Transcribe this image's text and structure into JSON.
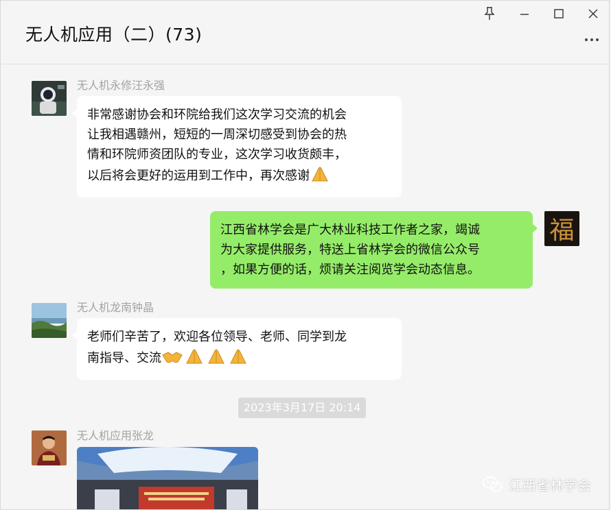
{
  "window": {
    "title": "无人机应用（二）(73)",
    "controls": [
      "pin-icon",
      "minimize-icon",
      "maximize-icon",
      "close-icon"
    ],
    "more_icon": "more-icon"
  },
  "messages": [
    {
      "sender": "无人机永修汪永强",
      "lines": [
        "非常感谢协会和环院给我们这次学习交流的机会",
        "让我相遇赣州，短短的一周深切感受到协会的热",
        "情和环院师资团队的专业，这次学习收货颇丰，",
        "以后将会更好的运用到工作中，再次感谢"
      ],
      "emoji": [
        "folded-hands"
      ],
      "avatar": "astronaut-avatar"
    },
    {
      "sender": "",
      "lines": [
        "江西省林学会是广大林业科技工作者之家，竭诚",
        "为大家提供服务，特送上省林学会的微信公众号",
        "，如果方便的话，烦请关注阅览学会动态信息。"
      ],
      "avatar": "fu-character-avatar"
    },
    {
      "sender": "无人机龙南钟晶",
      "lines": [
        "老师们辛苦了，欢迎各位领导、老师、同学到龙",
        "南指导、交流"
      ],
      "emoji": [
        "handshake",
        "folded-hands",
        "folded-hands",
        "folded-hands"
      ],
      "avatar": "landscape-avatar"
    }
  ],
  "timestamp": "2023年3月17日 20:14",
  "last_message": {
    "sender": "无人机应用张龙",
    "avatar": "person-avatar",
    "attachment": "conference-room-photo"
  },
  "watermark": "江西省林学会",
  "colors": {
    "background": "#f5f5f5",
    "bubble_me": "#95ec69",
    "bubble_other": "#ffffff",
    "sender_name": "#a3a3a3",
    "timestamp_bg": "#dadada"
  }
}
